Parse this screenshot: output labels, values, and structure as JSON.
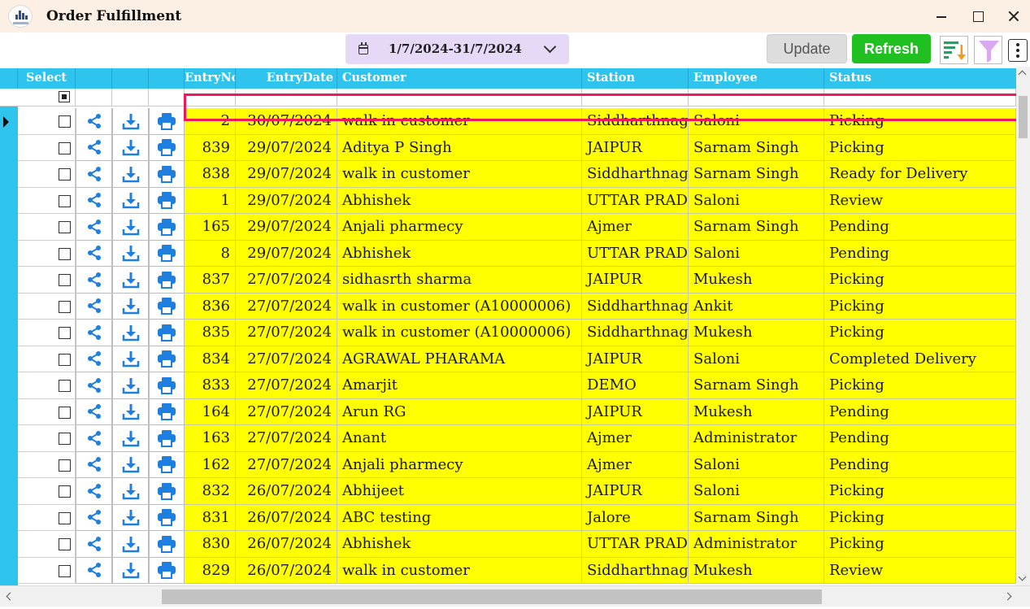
{
  "window": {
    "title": "Order Fulfillment"
  },
  "toolbar": {
    "date_range": "1/7/2024-31/7/2024",
    "update_label": "Update",
    "refresh_label": "Refresh",
    "sort_icon": "sort-descending-icon",
    "filter_icon": "filter-funnel-icon",
    "more_icon": "more-vertical-icon"
  },
  "grid": {
    "columns": {
      "select": "Select",
      "entry_no": "EntryNo",
      "entry_date": "EntryDate",
      "customer": "Customer",
      "station": "Station",
      "employee": "Employee",
      "status": "Status"
    },
    "row_action_icons": [
      "share-icon",
      "download-icon",
      "print-icon"
    ],
    "colors": {
      "header": "#2fc4ee",
      "row": "#ffff00",
      "highlight": "#f0185a",
      "icon": "#1f7fe0"
    },
    "highlighted_entry": "838",
    "rows": [
      {
        "entry_no": "2",
        "entry_date": "30/07/2024",
        "customer": "walk in customer",
        "station": "Siddharthnagar",
        "employee": "Saloni",
        "status": "Picking"
      },
      {
        "entry_no": "839",
        "entry_date": "29/07/2024",
        "customer": "Aditya P Singh",
        "station": "JAIPUR",
        "employee": "Sarnam Singh",
        "status": "Picking"
      },
      {
        "entry_no": "838",
        "entry_date": "29/07/2024",
        "customer": "walk in customer",
        "station": "Siddharthnagar",
        "employee": "Sarnam Singh",
        "status": "Ready for Delivery"
      },
      {
        "entry_no": "1",
        "entry_date": "29/07/2024",
        "customer": "Abhishek",
        "station": "UTTAR PRADESH",
        "employee": "Saloni",
        "status": "Review"
      },
      {
        "entry_no": "165",
        "entry_date": "29/07/2024",
        "customer": "Anjali  pharmecy",
        "station": "Ajmer",
        "employee": "Sarnam Singh",
        "status": "Pending"
      },
      {
        "entry_no": "8",
        "entry_date": "29/07/2024",
        "customer": "Abhishek",
        "station": "UTTAR PRADESH",
        "employee": "Saloni",
        "status": "Pending"
      },
      {
        "entry_no": "837",
        "entry_date": "27/07/2024",
        "customer": "sidhasrth sharma",
        "station": "JAIPUR",
        "employee": "Mukesh",
        "status": "Picking"
      },
      {
        "entry_no": "836",
        "entry_date": "27/07/2024",
        "customer": "walk in customer (A10000006)",
        "station": "Siddharthnagar",
        "employee": "Ankit",
        "status": "Picking"
      },
      {
        "entry_no": "835",
        "entry_date": "27/07/2024",
        "customer": "walk in customer (A10000006)",
        "station": "Siddharthnagar",
        "employee": "Mukesh",
        "status": "Picking"
      },
      {
        "entry_no": "834",
        "entry_date": "27/07/2024",
        "customer": "AGRAWAL PHARAMA",
        "station": "JAIPUR",
        "employee": "Saloni",
        "status": "Completed Delivery"
      },
      {
        "entry_no": "833",
        "entry_date": "27/07/2024",
        "customer": "Amarjit",
        "station": "DEMO",
        "employee": "Sarnam Singh",
        "status": "Picking"
      },
      {
        "entry_no": "164",
        "entry_date": "27/07/2024",
        "customer": "Arun RG",
        "station": "JAIPUR",
        "employee": "Mukesh",
        "status": "Pending"
      },
      {
        "entry_no": "163",
        "entry_date": "27/07/2024",
        "customer": "Anant",
        "station": "Ajmer",
        "employee": "Administrator",
        "status": "Pending"
      },
      {
        "entry_no": "162",
        "entry_date": "27/07/2024",
        "customer": "Anjali  pharmecy",
        "station": "Ajmer",
        "employee": "Saloni",
        "status": "Pending"
      },
      {
        "entry_no": "832",
        "entry_date": "26/07/2024",
        "customer": "Abhijeet",
        "station": "JAIPUR",
        "employee": "Saloni",
        "status": "Picking"
      },
      {
        "entry_no": "831",
        "entry_date": "26/07/2024",
        "customer": "ABC testing",
        "station": "Jalore",
        "employee": "Sarnam Singh",
        "status": "Picking"
      },
      {
        "entry_no": "830",
        "entry_date": "26/07/2024",
        "customer": "Abhishek",
        "station": "UTTAR PRADESH",
        "employee": "Administrator",
        "status": "Picking"
      },
      {
        "entry_no": "829",
        "entry_date": "26/07/2024",
        "customer": "walk in customer",
        "station": "Siddharthnagar",
        "employee": "Mukesh",
        "status": "Review"
      }
    ]
  }
}
